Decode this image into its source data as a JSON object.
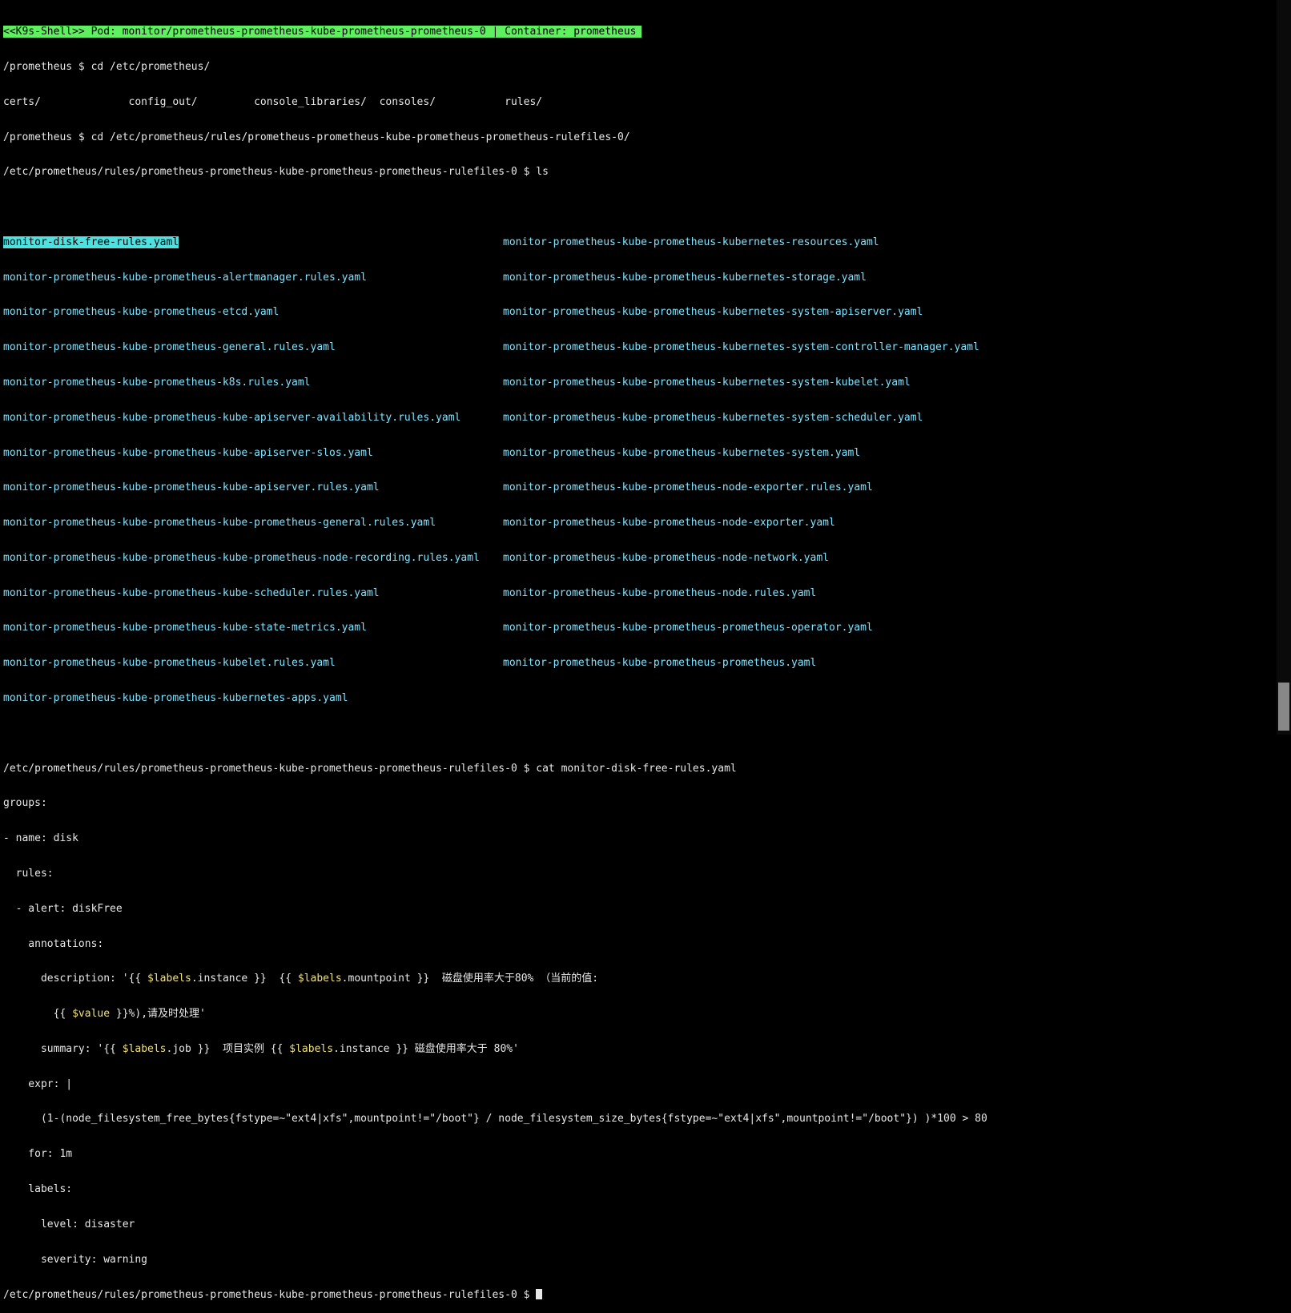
{
  "banner": "<<K9s-Shell>> Pod: monitor/prometheus-prometheus-kube-prometheus-prometheus-0 | Container: prometheus",
  "lines_before_ls": [
    "/prometheus $ cd /etc/prometheus/",
    "certs/              config_out/         console_libraries/  consoles/           rules/",
    "/prometheus $ cd /etc/prometheus/rules/prometheus-prometheus-kube-prometheus-prometheus-rulefiles-0/",
    "/etc/prometheus/rules/prometheus-prometheus-kube-prometheus-prometheus-rulefiles-0 $ ls"
  ],
  "ls_col1": [
    "monitor-disk-free-rules.yaml",
    "monitor-prometheus-kube-prometheus-alertmanager.rules.yaml",
    "monitor-prometheus-kube-prometheus-etcd.yaml",
    "monitor-prometheus-kube-prometheus-general.rules.yaml",
    "monitor-prometheus-kube-prometheus-k8s.rules.yaml",
    "monitor-prometheus-kube-prometheus-kube-apiserver-availability.rules.yaml",
    "monitor-prometheus-kube-prometheus-kube-apiserver-slos.yaml",
    "monitor-prometheus-kube-prometheus-kube-apiserver.rules.yaml",
    "monitor-prometheus-kube-prometheus-kube-prometheus-general.rules.yaml",
    "monitor-prometheus-kube-prometheus-kube-prometheus-node-recording.rules.yaml",
    "monitor-prometheus-kube-prometheus-kube-scheduler.rules.yaml",
    "monitor-prometheus-kube-prometheus-kube-state-metrics.yaml",
    "monitor-prometheus-kube-prometheus-kubelet.rules.yaml",
    "monitor-prometheus-kube-prometheus-kubernetes-apps.yaml"
  ],
  "ls_col2": [
    "monitor-prometheus-kube-prometheus-kubernetes-resources.yaml",
    "monitor-prometheus-kube-prometheus-kubernetes-storage.yaml",
    "monitor-prometheus-kube-prometheus-kubernetes-system-apiserver.yaml",
    "monitor-prometheus-kube-prometheus-kubernetes-system-controller-manager.yaml",
    "monitor-prometheus-kube-prometheus-kubernetes-system-kubelet.yaml",
    "monitor-prometheus-kube-prometheus-kubernetes-system-scheduler.yaml",
    "monitor-prometheus-kube-prometheus-kubernetes-system.yaml",
    "monitor-prometheus-kube-prometheus-node-exporter.rules.yaml",
    "monitor-prometheus-kube-prometheus-node-exporter.yaml",
    "monitor-prometheus-kube-prometheus-node-network.yaml",
    "monitor-prometheus-kube-prometheus-node.rules.yaml",
    "monitor-prometheus-kube-prometheus-prometheus-operator.yaml",
    "monitor-prometheus-kube-prometheus-prometheus.yaml",
    ""
  ],
  "cat_cmd": "/etc/prometheus/rules/prometheus-prometheus-kube-prometheus-prometheus-rulefiles-0 $ cat monitor-disk-free-rules.yaml",
  "yaml": {
    "l1": "groups:",
    "l2": "- name: disk",
    "l3": "  rules:",
    "l4": "  - alert: diskFree",
    "l5": "    annotations:",
    "desc_a": "      description: '{{ ",
    "var_labels": "$labels",
    "desc_b": ".instance }}  {{ ",
    "desc_c": ".mountpoint }}  磁盘使用率大于80% （当前的值:",
    "desc2_a": "        {{ ",
    "var_value": "$value",
    "desc2_b": " }}%),请及时处理'",
    "sum_a": "      summary: '{{ ",
    "sum_b": ".job }}  项目实例 {{ ",
    "sum_c": ".instance }} 磁盘使用率大于 80%'",
    "l9": "    expr: |",
    "l10": "      (1-(node_filesystem_free_bytes{fstype=~\"ext4|xfs\",mountpoint!=\"/boot\"} / node_filesystem_size_bytes{fstype=~\"ext4|xfs\",mountpoint!=\"/boot\"}) )*100 > 80",
    "l11": "    for: 1m",
    "l12": "    labels:",
    "l13": "      level: disaster",
    "l14": "      severity: warning"
  },
  "prompt": "/etc/prometheus/rules/prometheus-prometheus-kube-prometheus-prometheus-rulefiles-0 $ "
}
